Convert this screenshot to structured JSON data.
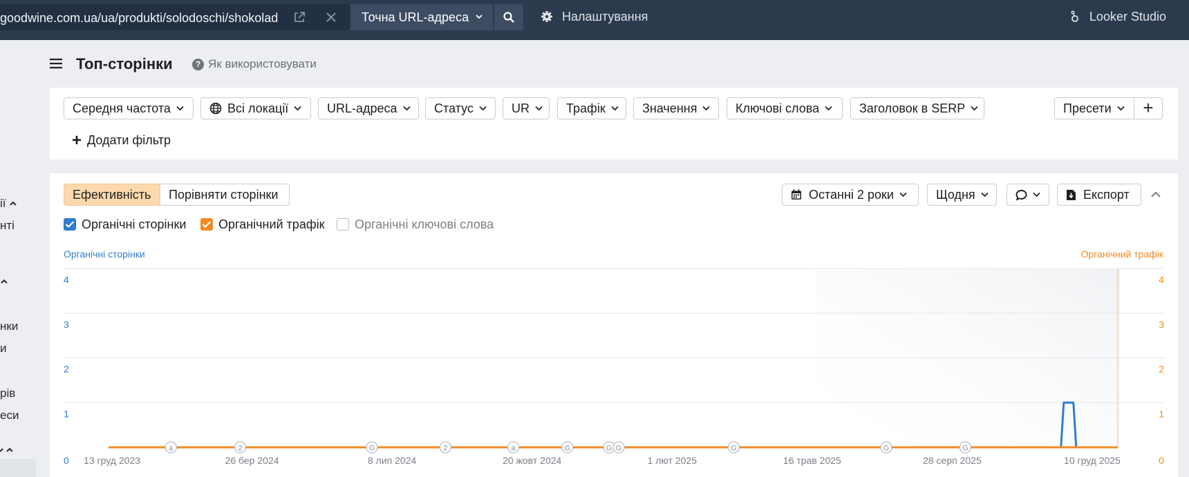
{
  "topbar": {
    "url_value": "goodwine.com.ua/ua/produkti/solodoschi/shokolad",
    "mode_label": "Точна URL-адреса",
    "settings_label": "Налаштування",
    "looker_label": "Looker Studio"
  },
  "sidebar_fragments": [
    "ії",
    "нті",
    "нки",
    "и",
    "рів",
    "еси"
  ],
  "header": {
    "title": "Топ-сторінки",
    "help_label": "Як використовувати"
  },
  "filters": {
    "items": [
      "Середня частота",
      "Всі локації",
      "URL-адреса",
      "Статус",
      "UR",
      "Трафік",
      "Значення",
      "Ключові слова",
      "Заголовок в SERP"
    ],
    "presets_label": "Пресети",
    "add_filter_label": "Додати фільтр"
  },
  "toolbar": {
    "tab_performance": "Ефективність",
    "tab_compare": "Порівняти сторінки",
    "period_label": "Останні 2 роки",
    "granularity_label": "Щодня",
    "export_label": "Експорт"
  },
  "legend": {
    "organic_pages": "Органічні сторінки",
    "organic_traffic": "Органічний трафік",
    "organic_keywords": "Органічні ключові слова",
    "organic_pages_checked": true,
    "organic_traffic_checked": true,
    "organic_keywords_checked": false
  },
  "colors": {
    "pages": "#2f7dd0",
    "traffic": "#f08a24",
    "accent_tab": "#fdd9ae"
  },
  "chart_data": {
    "type": "line",
    "left_axis_title": "Органічні сторінки",
    "right_axis_title": "Органічний трафік",
    "y_ticks": [
      0,
      1,
      2,
      3,
      4
    ],
    "ylim": [
      0,
      4
    ],
    "x_tick_labels": [
      "13 груд 2023",
      "26 бер 2024",
      "8 лип 2024",
      "20 жовт 2024",
      "1 лют 2025",
      "16 трав 2025",
      "28 серп 2025",
      "10 груд 2025"
    ],
    "x_range": [
      "2023-12-13",
      "2025-12-10"
    ],
    "grid": true,
    "series": [
      {
        "name": "Органічні сторінки",
        "axis": "left",
        "points": [
          [
            "2023-12-13",
            0
          ],
          [
            "2025-10-30",
            0
          ],
          [
            "2025-11-01",
            1
          ],
          [
            "2025-11-08",
            1
          ],
          [
            "2025-11-10",
            0
          ],
          [
            "2025-12-10",
            0
          ]
        ]
      },
      {
        "name": "Органічний трафік",
        "axis": "right",
        "points": [
          [
            "2023-12-13",
            0
          ],
          [
            "2025-12-10",
            0
          ]
        ]
      }
    ],
    "annotations": [
      {
        "label": "a",
        "date": "2024-01-27"
      },
      {
        "label": "2",
        "date": "2024-03-17"
      },
      {
        "label": "G",
        "date": "2024-06-20"
      },
      {
        "label": "2",
        "date": "2024-08-12"
      },
      {
        "label": "a",
        "date": "2024-09-30"
      },
      {
        "label": "G",
        "date": "2024-11-08"
      },
      {
        "label": "G",
        "date": "2024-12-08"
      },
      {
        "label": "G",
        "date": "2024-12-15"
      },
      {
        "label": "G",
        "date": "2025-03-08"
      },
      {
        "label": "G",
        "date": "2025-06-26"
      },
      {
        "label": "G",
        "date": "2025-08-22"
      }
    ]
  }
}
